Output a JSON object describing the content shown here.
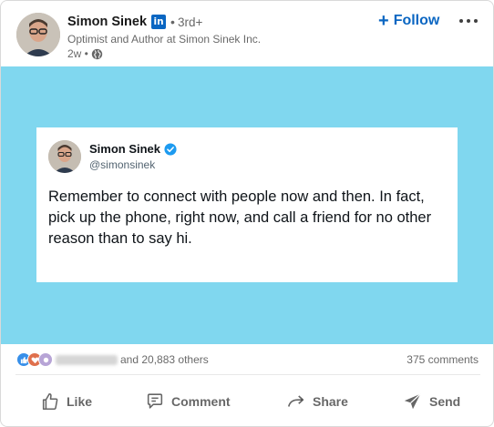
{
  "post": {
    "author": {
      "name": "Simon Sinek",
      "network_badge": "in",
      "degree": "3rd+",
      "headline": "Optimist and Author at Simon Sinek Inc.",
      "age": "2w",
      "visibility_icon": "globe-icon"
    },
    "header_actions": {
      "follow_label": "Follow",
      "more_icon": "ellipsis-icon"
    },
    "media": {
      "background_color": "#80d7ef",
      "tweet": {
        "name": "Simon Sinek",
        "handle": "@simonsinek",
        "verified": true,
        "text": "Remember to connect with people now and then. In fact, pick up the phone, right now, and call a friend for no other reason than to say hi."
      }
    },
    "social_counts": {
      "reaction_icons": [
        "like-reaction-icon",
        "love-reaction-icon",
        "support-reaction-icon"
      ],
      "others_text": "and 20,883 others",
      "comments_text": "375 comments"
    },
    "actions": [
      {
        "label": "Like",
        "icon": "thumbs-up-icon"
      },
      {
        "label": "Comment",
        "icon": "comment-icon"
      },
      {
        "label": "Share",
        "icon": "share-arrow-icon"
      },
      {
        "label": "Send",
        "icon": "send-icon"
      }
    ],
    "colors": {
      "accent": "#0a66c2",
      "media_bg": "#80d7ef",
      "verified": "#1d9bf0"
    }
  }
}
